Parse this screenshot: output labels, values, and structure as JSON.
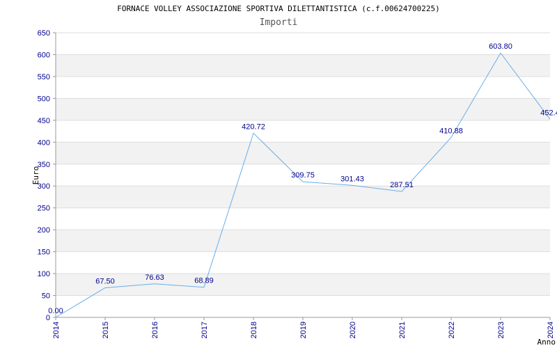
{
  "chart_data": {
    "type": "line",
    "title": "FORNACE VOLLEY ASSOCIAZIONE SPORTIVA DILETTANTISTICA (c.f.00624700225)",
    "subtitle": "Importi",
    "xlabel": "Anno",
    "ylabel": "Euro",
    "categories": [
      "2014",
      "2015",
      "2016",
      "2017",
      "2018",
      "2019",
      "2020",
      "2021",
      "2022",
      "2023",
      "2024"
    ],
    "values": [
      0.0,
      67.5,
      76.63,
      68.89,
      420.72,
      309.75,
      301.43,
      287.51,
      410.88,
      603.8,
      452.4
    ],
    "value_labels": [
      "0.00",
      "67.50",
      "76.63",
      "68.89",
      "420.72",
      "309.75",
      "301.43",
      "287.51",
      "410.88",
      "603.80",
      "452.4"
    ],
    "ylim": [
      0,
      650
    ],
    "yticks": [
      "0",
      "50",
      "100",
      "150",
      "200",
      "250",
      "300",
      "350",
      "400",
      "450",
      "500",
      "550",
      "600",
      "650"
    ],
    "grid": true,
    "line_color": "#6aaee6",
    "tick_color": "#00008b",
    "band_color": "#f2f2f2"
  }
}
